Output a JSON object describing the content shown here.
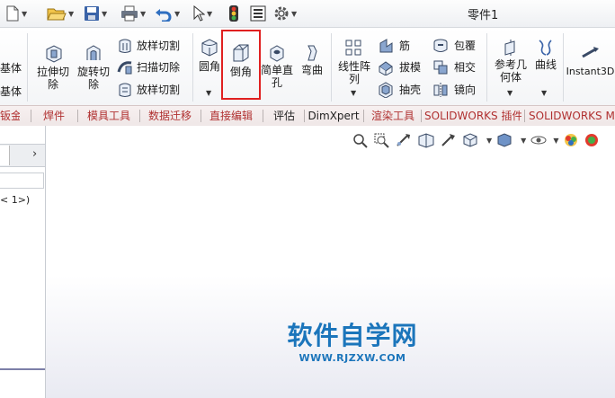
{
  "window": {
    "title": "零件1"
  },
  "ribbon": {
    "left_cut_labels": [
      "基体",
      "基体"
    ],
    "extrude_cut": "拉伸切\n除",
    "revolve_cut": "旋转切\n除",
    "loft_cut": "放样切割",
    "sweep_cut": "扫描切除",
    "loft_cut2": "放样切割",
    "fillet": "圆角",
    "chamfer": "倒角",
    "simple_hole": "简单直\n孔",
    "bend": "弯曲",
    "linear_pattern": "线性阵\n列",
    "rib": "筋",
    "draft": "拔模",
    "shell": "抽壳",
    "wrap": "包覆",
    "intersect": "相交",
    "mirror": "镜向",
    "ref_geometry": "参考几\n何体",
    "curves": "曲线",
    "instant3d": "Instant3D"
  },
  "tabs": [
    {
      "label": "钣金"
    },
    {
      "label": "焊件"
    },
    {
      "label": "模具工具"
    },
    {
      "label": "数据迁移"
    },
    {
      "label": "直接编辑"
    },
    {
      "label": "评估"
    },
    {
      "label": "DimXpert"
    },
    {
      "label": "渲染工具"
    },
    {
      "label": "SOLIDWORKS 插件"
    },
    {
      "label": "SOLIDWORKS MBD"
    }
  ],
  "left_panel": {
    "tree_node": "< 1>)"
  },
  "watermark": {
    "title": "软件自学网",
    "url": "WWW.RJZXW.COM"
  },
  "colors": {
    "accent_red": "#e02020",
    "watermark_blue": "#1b75bb",
    "tab_text": "#b03030"
  },
  "icons": {
    "new": "new-document-icon",
    "open": "open-folder-icon",
    "save": "save-icon",
    "print": "print-icon",
    "undo": "undo-icon",
    "select": "select-arrow-icon",
    "traffic": "rebuild-traffic-light-icon",
    "file_props": "file-properties-icon",
    "options": "gear-icon"
  }
}
